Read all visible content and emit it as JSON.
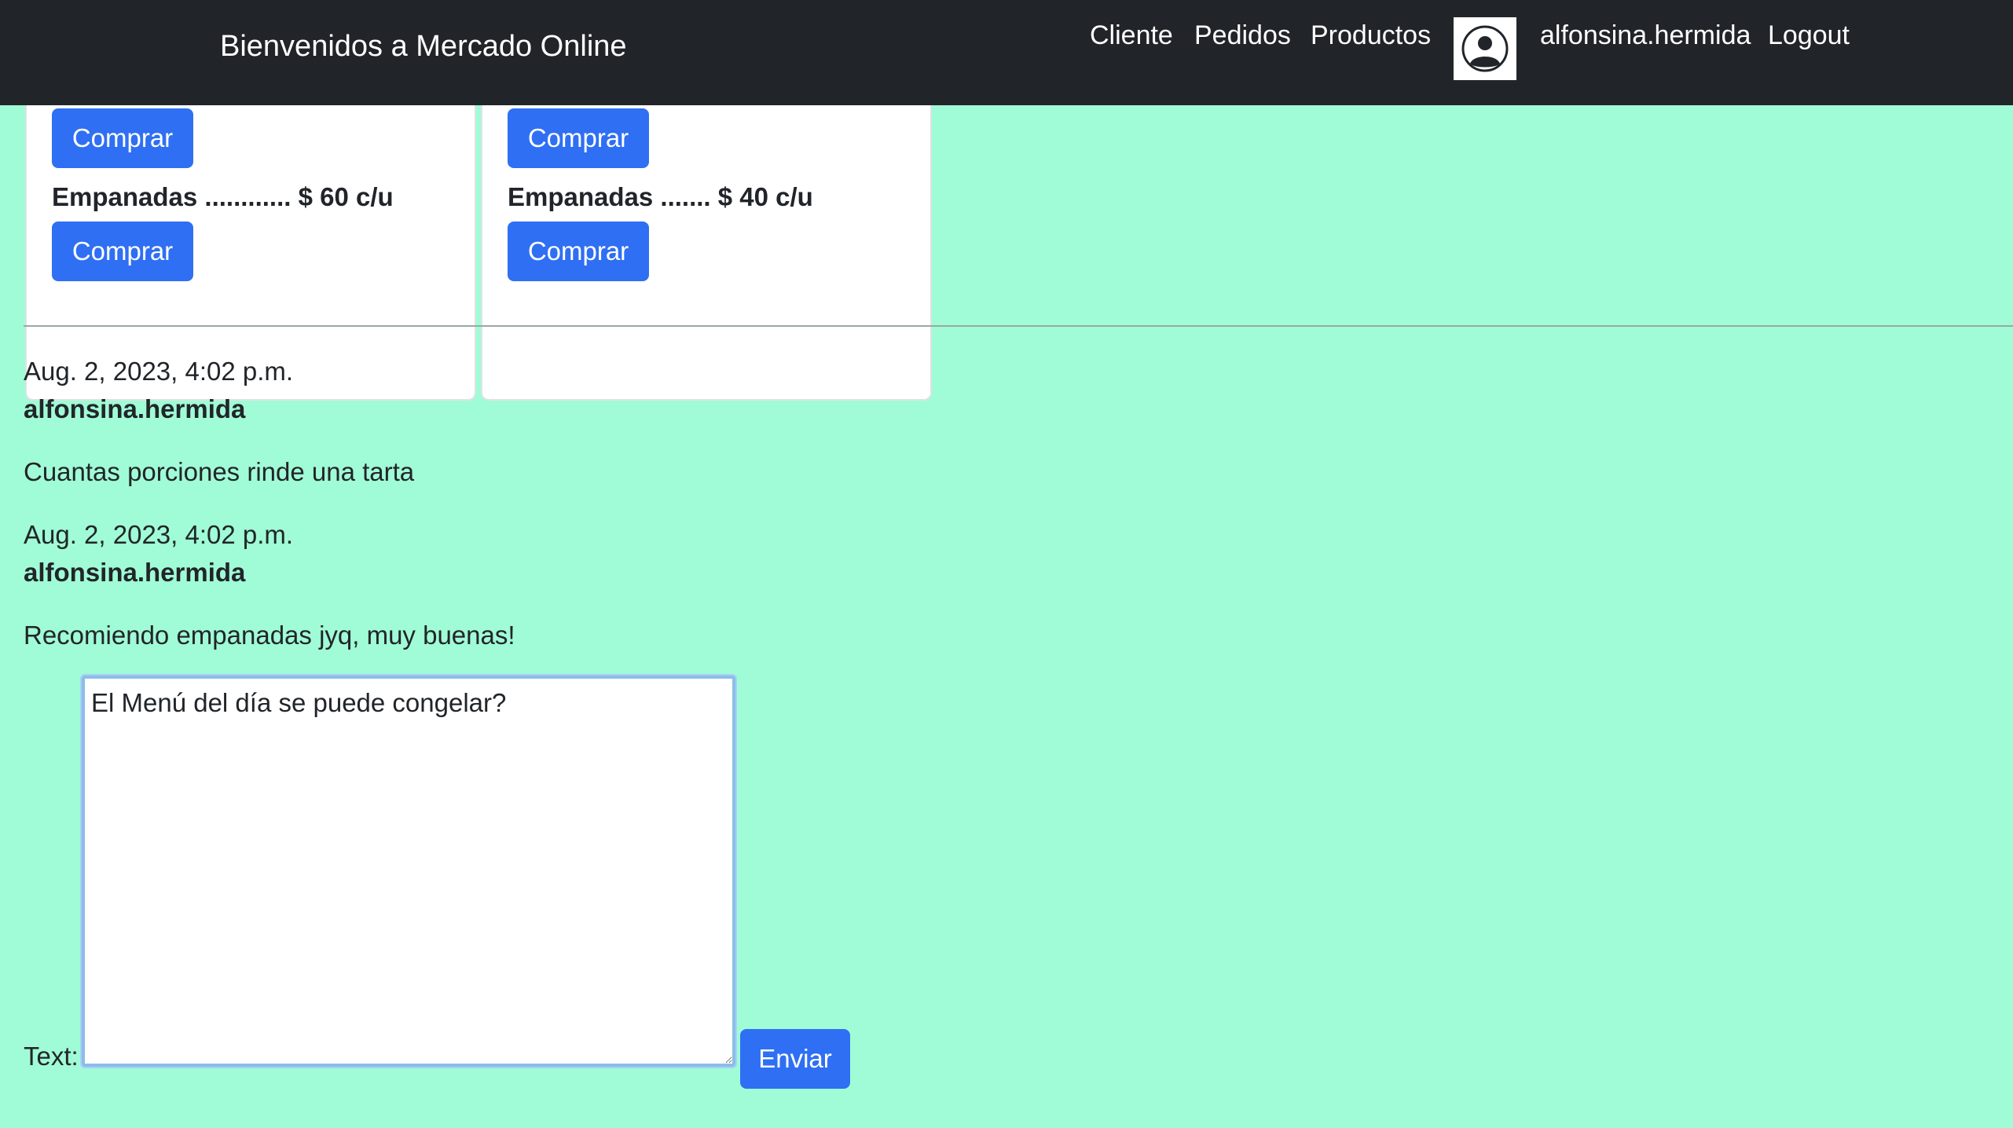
{
  "navbar": {
    "brand": "Bienvenidos a Mercado Online",
    "links": [
      "Cliente",
      "Pedidos",
      "Productos"
    ],
    "username": "alfonsina.hermida",
    "logout": "Logout"
  },
  "products": {
    "cards": [
      {
        "top_button": "Comprar",
        "item": "Empanadas ............ $ 60 c/u",
        "bottom_button": "Comprar"
      },
      {
        "top_button": "Comprar",
        "item": "Empanadas ....... $ 40 c/u",
        "bottom_button": "Comprar"
      }
    ]
  },
  "messages": [
    {
      "date": "Aug. 2, 2023, 4:02 p.m.",
      "author": "alfonsina.hermida",
      "text": "Cuantas porciones rinde una tarta"
    },
    {
      "date": "Aug. 2, 2023, 4:02 p.m.",
      "author": "alfonsina.hermida",
      "text": "Recomiendo empanadas jyq, muy buenas!"
    }
  ],
  "form": {
    "label": "Text:",
    "value": "El Menú del día se puede congelar?",
    "submit": "Enviar"
  }
}
